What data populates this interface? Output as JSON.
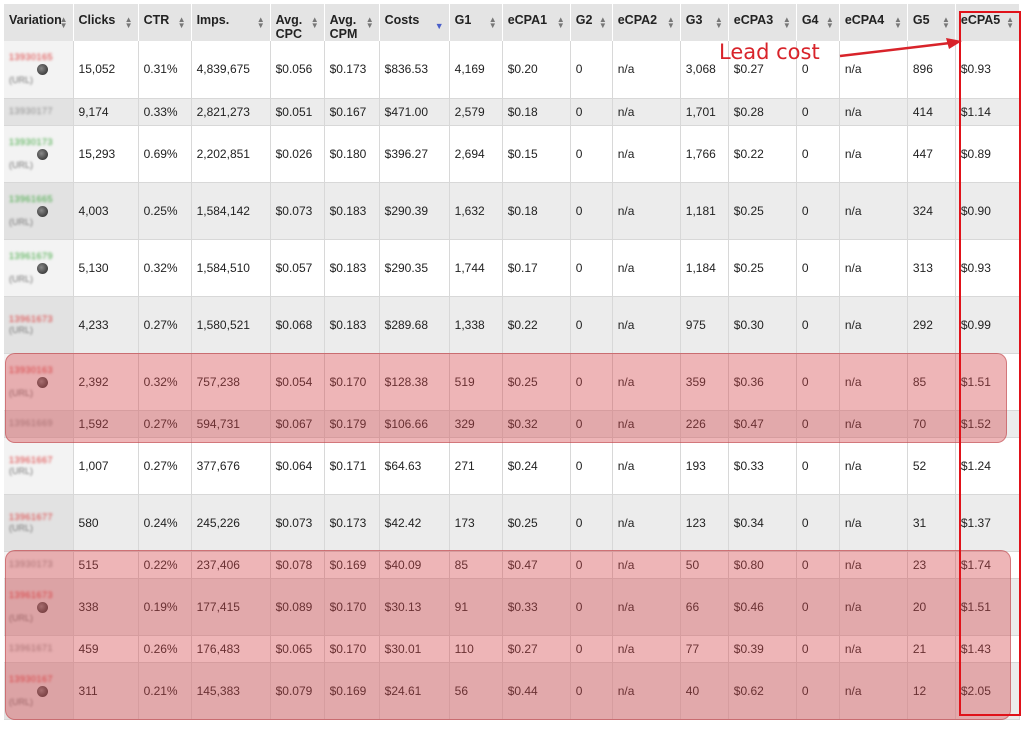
{
  "columns": [
    {
      "key": "variation",
      "label": "Variation",
      "width": 69
    },
    {
      "key": "clicks",
      "label": "Clicks",
      "width": 65
    },
    {
      "key": "ctr",
      "label": "CTR",
      "width": 53
    },
    {
      "key": "imps",
      "label": "Imps.",
      "width": 79
    },
    {
      "key": "avg_cpc",
      "label": "Avg. CPC",
      "width": 54
    },
    {
      "key": "avg_cpm",
      "label": "Avg. CPM",
      "width": 55
    },
    {
      "key": "costs",
      "label": "Costs",
      "width": 70,
      "sorted": "desc"
    },
    {
      "key": "g1",
      "label": "G1",
      "width": 53
    },
    {
      "key": "ecpa1",
      "label": "eCPA1",
      "width": 68
    },
    {
      "key": "g2",
      "label": "G2",
      "width": 42
    },
    {
      "key": "ecpa2",
      "label": "eCPA2",
      "width": 68
    },
    {
      "key": "g3",
      "label": "G3",
      "width": 48
    },
    {
      "key": "ecpa3",
      "label": "eCPA3",
      "width": 68
    },
    {
      "key": "g4",
      "label": "G4",
      "width": 43
    },
    {
      "key": "ecpa4",
      "label": "eCPA4",
      "width": 68
    },
    {
      "key": "g5",
      "label": "G5",
      "width": 48
    },
    {
      "key": "ecpa5",
      "label": "eCPA5",
      "width": 64
    }
  ],
  "rows": [
    {
      "variation": "13930165",
      "id_color": "red",
      "has_dot": true,
      "has_link": true,
      "clicks": "15,052",
      "ctr": "0.31%",
      "imps": "4,839,675",
      "avg_cpc": "$0.056",
      "avg_cpm": "$0.173",
      "costs": "$836.53",
      "g1": "4,169",
      "ecpa1": "$0.20",
      "g2": "0",
      "ecpa2": "n/a",
      "g3": "3,068",
      "ecpa3": "$0.27",
      "g4": "0",
      "ecpa4": "n/a",
      "g5": "896",
      "ecpa5": "$0.93"
    },
    {
      "variation": "13930177",
      "id_color": "gray",
      "has_dot": false,
      "has_link": false,
      "clicks": "9,174",
      "ctr": "0.33%",
      "imps": "2,821,273",
      "avg_cpc": "$0.051",
      "avg_cpm": "$0.167",
      "costs": "$471.00",
      "g1": "2,579",
      "ecpa1": "$0.18",
      "g2": "0",
      "ecpa2": "n/a",
      "g3": "1,701",
      "ecpa3": "$0.28",
      "g4": "0",
      "ecpa4": "n/a",
      "g5": "414",
      "ecpa5": "$1.14"
    },
    {
      "variation": "13930173",
      "id_color": "green",
      "has_dot": true,
      "has_link": true,
      "clicks": "15,293",
      "ctr": "0.69%",
      "imps": "2,202,851",
      "avg_cpc": "$0.026",
      "avg_cpm": "$0.180",
      "costs": "$396.27",
      "g1": "2,694",
      "ecpa1": "$0.15",
      "g2": "0",
      "ecpa2": "n/a",
      "g3": "1,766",
      "ecpa3": "$0.22",
      "g4": "0",
      "ecpa4": "n/a",
      "g5": "447",
      "ecpa5": "$0.89"
    },
    {
      "variation": "13961665",
      "id_color": "green",
      "has_dot": true,
      "has_link": true,
      "clicks": "4,003",
      "ctr": "0.25%",
      "imps": "1,584,142",
      "avg_cpc": "$0.073",
      "avg_cpm": "$0.183",
      "costs": "$290.39",
      "g1": "1,632",
      "ecpa1": "$0.18",
      "g2": "0",
      "ecpa2": "n/a",
      "g3": "1,181",
      "ecpa3": "$0.25",
      "g4": "0",
      "ecpa4": "n/a",
      "g5": "324",
      "ecpa5": "$0.90"
    },
    {
      "variation": "13961679",
      "id_color": "green",
      "has_dot": true,
      "has_link": true,
      "clicks": "5,130",
      "ctr": "0.32%",
      "imps": "1,584,510",
      "avg_cpc": "$0.057",
      "avg_cpm": "$0.183",
      "costs": "$290.35",
      "g1": "1,744",
      "ecpa1": "$0.17",
      "g2": "0",
      "ecpa2": "n/a",
      "g3": "1,184",
      "ecpa3": "$0.25",
      "g4": "0",
      "ecpa4": "n/a",
      "g5": "313",
      "ecpa5": "$0.93"
    },
    {
      "variation": "13961673",
      "id_color": "red",
      "has_dot": false,
      "has_link": true,
      "clicks": "4,233",
      "ctr": "0.27%",
      "imps": "1,580,521",
      "avg_cpc": "$0.068",
      "avg_cpm": "$0.183",
      "costs": "$289.68",
      "g1": "1,338",
      "ecpa1": "$0.22",
      "g2": "0",
      "ecpa2": "n/a",
      "g3": "975",
      "ecpa3": "$0.30",
      "g4": "0",
      "ecpa4": "n/a",
      "g5": "292",
      "ecpa5": "$0.99"
    },
    {
      "variation": "13930163",
      "id_color": "red",
      "has_dot": true,
      "has_link": true,
      "clicks": "2,392",
      "ctr": "0.32%",
      "imps": "757,238",
      "avg_cpc": "$0.054",
      "avg_cpm": "$0.170",
      "costs": "$128.38",
      "g1": "519",
      "ecpa1": "$0.25",
      "g2": "0",
      "ecpa2": "n/a",
      "g3": "359",
      "ecpa3": "$0.36",
      "g4": "0",
      "ecpa4": "n/a",
      "g5": "85",
      "ecpa5": "$1.51"
    },
    {
      "variation": "13961669",
      "id_color": "gray",
      "has_dot": false,
      "has_link": false,
      "clicks": "1,592",
      "ctr": "0.27%",
      "imps": "594,731",
      "avg_cpc": "$0.067",
      "avg_cpm": "$0.179",
      "costs": "$106.66",
      "g1": "329",
      "ecpa1": "$0.32",
      "g2": "0",
      "ecpa2": "n/a",
      "g3": "226",
      "ecpa3": "$0.47",
      "g4": "0",
      "ecpa4": "n/a",
      "g5": "70",
      "ecpa5": "$1.52"
    },
    {
      "variation": "13961667",
      "id_color": "red",
      "has_dot": false,
      "has_link": true,
      "clicks": "1,007",
      "ctr": "0.27%",
      "imps": "377,676",
      "avg_cpc": "$0.064",
      "avg_cpm": "$0.171",
      "costs": "$64.63",
      "g1": "271",
      "ecpa1": "$0.24",
      "g2": "0",
      "ecpa2": "n/a",
      "g3": "193",
      "ecpa3": "$0.33",
      "g4": "0",
      "ecpa4": "n/a",
      "g5": "52",
      "ecpa5": "$1.24"
    },
    {
      "variation": "13961677",
      "id_color": "red",
      "has_dot": false,
      "has_link": true,
      "clicks": "580",
      "ctr": "0.24%",
      "imps": "245,226",
      "avg_cpc": "$0.073",
      "avg_cpm": "$0.173",
      "costs": "$42.42",
      "g1": "173",
      "ecpa1": "$0.25",
      "g2": "0",
      "ecpa2": "n/a",
      "g3": "123",
      "ecpa3": "$0.34",
      "g4": "0",
      "ecpa4": "n/a",
      "g5": "31",
      "ecpa5": "$1.37"
    },
    {
      "variation": "13930173",
      "id_color": "gray",
      "has_dot": false,
      "has_link": false,
      "clicks": "515",
      "ctr": "0.22%",
      "imps": "237,406",
      "avg_cpc": "$0.078",
      "avg_cpm": "$0.169",
      "costs": "$40.09",
      "g1": "85",
      "ecpa1": "$0.47",
      "g2": "0",
      "ecpa2": "n/a",
      "g3": "50",
      "ecpa3": "$0.80",
      "g4": "0",
      "ecpa4": "n/a",
      "g5": "23",
      "ecpa5": "$1.74"
    },
    {
      "variation": "13961673",
      "id_color": "red",
      "has_dot": true,
      "has_link": true,
      "clicks": "338",
      "ctr": "0.19%",
      "imps": "177,415",
      "avg_cpc": "$0.089",
      "avg_cpm": "$0.170",
      "costs": "$30.13",
      "g1": "91",
      "ecpa1": "$0.33",
      "g2": "0",
      "ecpa2": "n/a",
      "g3": "66",
      "ecpa3": "$0.46",
      "g4": "0",
      "ecpa4": "n/a",
      "g5": "20",
      "ecpa5": "$1.51"
    },
    {
      "variation": "13961671",
      "id_color": "gray",
      "has_dot": false,
      "has_link": false,
      "clicks": "459",
      "ctr": "0.26%",
      "imps": "176,483",
      "avg_cpc": "$0.065",
      "avg_cpm": "$0.170",
      "costs": "$30.01",
      "g1": "110",
      "ecpa1": "$0.27",
      "g2": "0",
      "ecpa2": "n/a",
      "g3": "77",
      "ecpa3": "$0.39",
      "g4": "0",
      "ecpa4": "n/a",
      "g5": "21",
      "ecpa5": "$1.43"
    },
    {
      "variation": "13930167",
      "id_color": "red",
      "has_dot": true,
      "has_link": true,
      "clicks": "311",
      "ctr": "0.21%",
      "imps": "145,383",
      "avg_cpc": "$0.079",
      "avg_cpm": "$0.169",
      "costs": "$24.61",
      "g1": "56",
      "ecpa1": "$0.44",
      "g2": "0",
      "ecpa2": "n/a",
      "g3": "40",
      "ecpa3": "$0.62",
      "g4": "0",
      "ecpa4": "n/a",
      "g5": "12",
      "ecpa5": "$2.05"
    }
  ],
  "variation_link_text": "(URL)",
  "annotation": {
    "text": "Lead cost",
    "color": "#d8232a"
  },
  "colors": {
    "header_bg": "#e4e4e4",
    "row_odd": "#ffffff",
    "row_even": "#ececec",
    "highlight_fill": "#d4464b",
    "column_outline": "#e0121a",
    "sort_active": "#4a5fc9"
  },
  "icons": {
    "sort": "sort-arrows-icon",
    "sort_active": "sort-desc-icon",
    "status_dot": "status-dot-icon"
  }
}
